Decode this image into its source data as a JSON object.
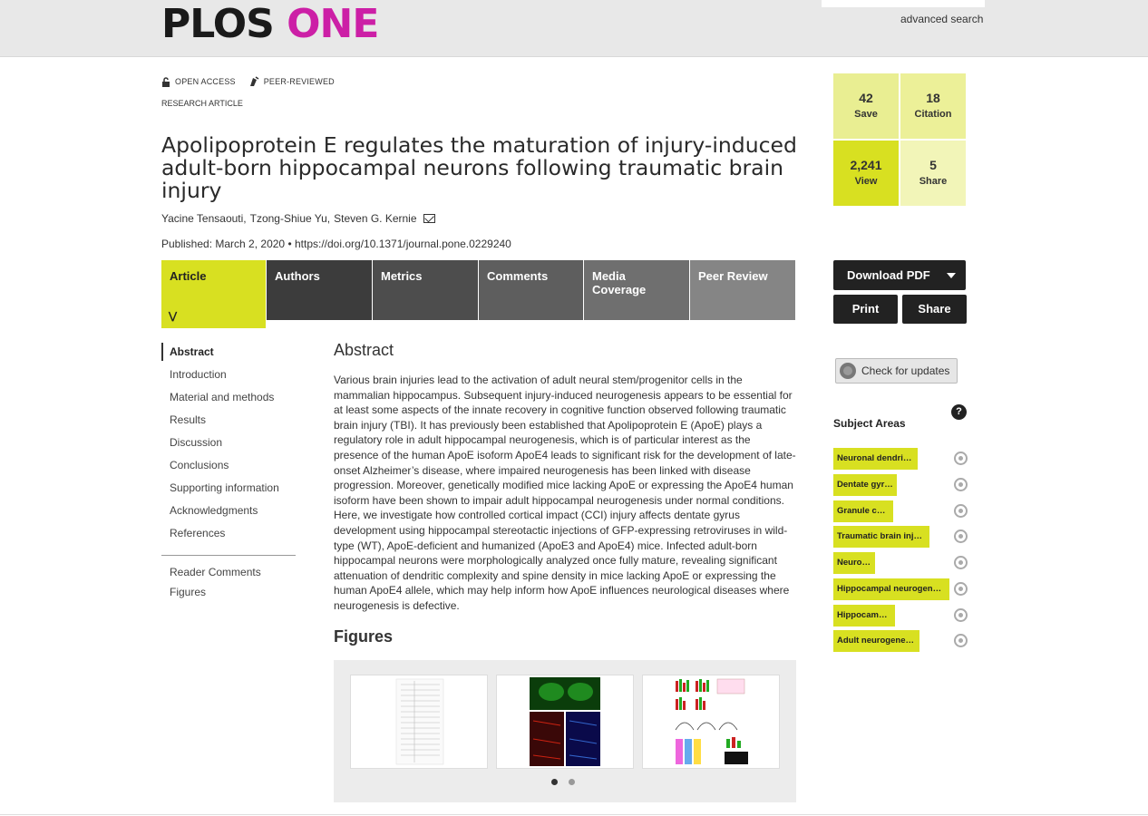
{
  "header": {
    "logo_plos": "PLOS",
    "logo_one": "ONE",
    "advanced_search": "advanced search"
  },
  "article": {
    "flag_open_access": "OPEN ACCESS",
    "flag_peer_reviewed": "PEER-REVIEWED",
    "type": "RESEARCH ARTICLE",
    "title": "Apolipoprotein E regulates the maturation of injury-induced adult-born hippocampal neurons following traumatic brain injury",
    "authors": [
      "Yacine Tensaouti,",
      "Tzong-Shiue Yu,",
      "Steven G. Kernie"
    ],
    "published": "Published: March 2, 2020",
    "doi": "https://doi.org/10.1371/journal.pone.0229240"
  },
  "tabs": [
    "Article",
    "Authors",
    "Metrics",
    "Comments",
    "Media Coverage",
    "Peer Review"
  ],
  "toc": {
    "items": [
      "Abstract",
      "Introduction",
      "Material and methods",
      "Results",
      "Discussion",
      "Conclusions",
      "Supporting information",
      "Acknowledgments",
      "References"
    ],
    "lower": [
      "Reader Comments",
      "Figures"
    ]
  },
  "main": {
    "abstract_heading": "Abstract",
    "abstract_text": "Various brain injuries lead to the activation of adult neural stem/progenitor cells in the mammalian hippocampus. Subsequent injury-induced neurogenesis appears to be essential for at least some aspects of the innate recovery in cognitive function observed following traumatic brain injury (TBI). It has previously been established that Apolipoprotein E (ApoE) plays a regulatory role in adult hippocampal neurogenesis, which is of particular interest as the presence of the human ApoE isoform ApoE4 leads to significant risk for the development of late-onset Alzheimer’s disease, where impaired neurogenesis has been linked with disease progression. Moreover, genetically modified mice lacking ApoE or expressing the ApoE4 human isoform have been shown to impair adult hippocampal neurogenesis under normal conditions. Here, we investigate how controlled cortical impact (CCI) injury affects dentate gyrus development using hippocampal stereotactic injections of GFP-expressing retroviruses in wild-type (WT), ApoE-deficient and humanized (ApoE3 and ApoE4) mice. Infected adult-born hippocampal neurons were morphologically analyzed once fully mature, revealing significant attenuation of dendritic complexity and spine density in mice lacking ApoE or expressing the human ApoE4 allele, which may help inform how ApoE influences neurological diseases where neurogenesis is defective.",
    "figures_heading": "Figures"
  },
  "metrics": [
    {
      "num": "42",
      "label": "Save"
    },
    {
      "num": "18",
      "label": "Citation"
    },
    {
      "num": "2,241",
      "label": "View"
    },
    {
      "num": "5",
      "label": "Share"
    }
  ],
  "actions": {
    "download_pdf": "Download PDF",
    "print": "Print",
    "share": "Share",
    "check_updates": "Check for updates"
  },
  "subjects": {
    "heading": "Subject Areas",
    "help": "?",
    "items": [
      "Neuronal dendrites",
      "Dentate gyrus",
      "Granule cells",
      "Traumatic brain injury",
      "Neurons",
      "Hippocampal neurogenesis",
      "Hippocampus",
      "Adult neurogenesis"
    ]
  },
  "colors": {
    "accent": "#d8e021",
    "brand_magenta": "#cc1fa6",
    "dark": "#222222"
  }
}
